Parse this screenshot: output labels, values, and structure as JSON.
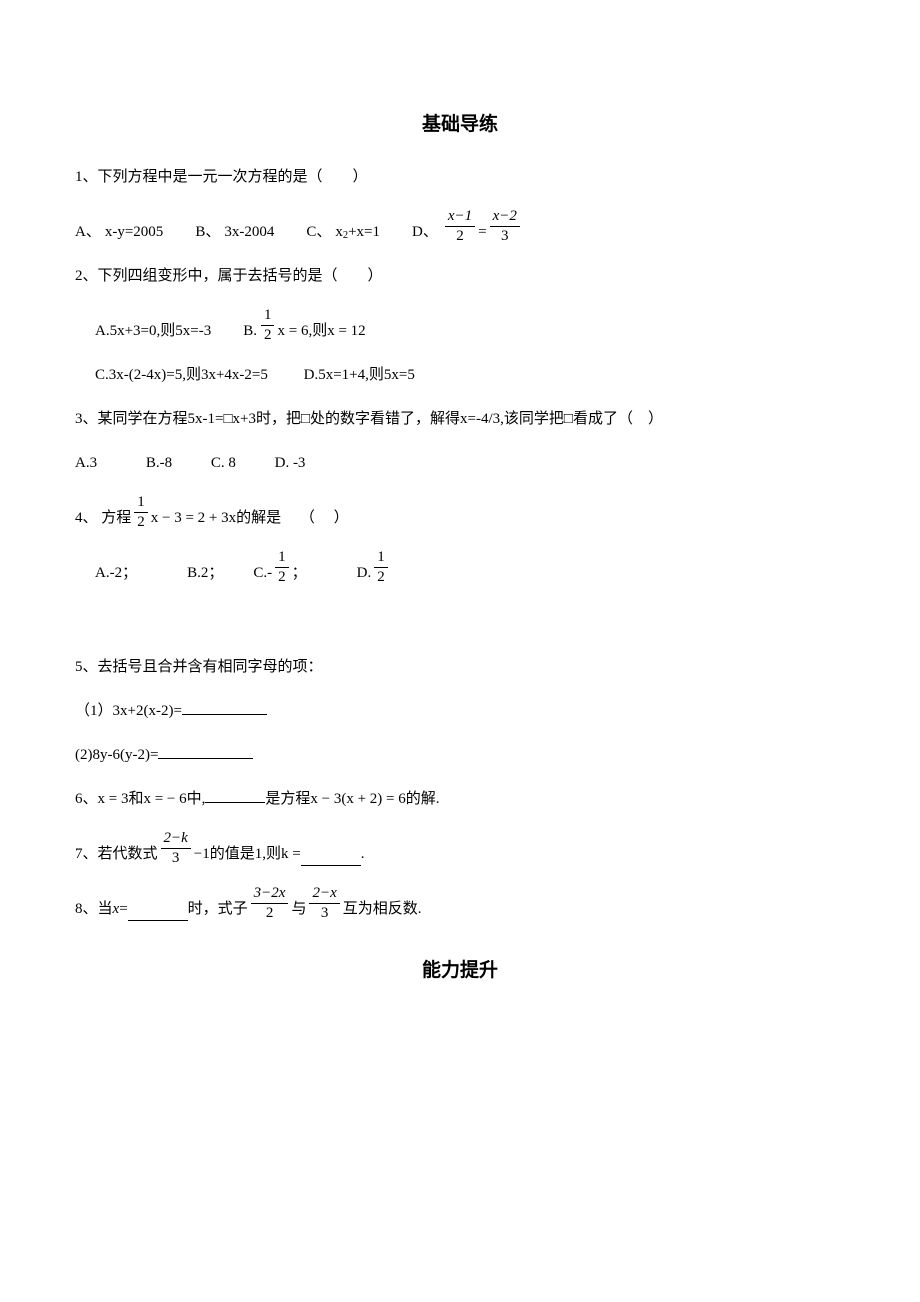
{
  "section_a_title": "基础导练",
  "section_b_title": "能力提升",
  "q1": {
    "stem": "1、下列方程中是一元一次方程的是（　　）",
    "a_lab": "A、",
    "a_txt": "x-y=2005",
    "b_lab": "B、",
    "b_txt": "3x-2004",
    "c_lab": "C、",
    "c_txt_pre": "x",
    "c_txt_post": "+x=1",
    "d_lab": "D、",
    "d_num1": "x−1",
    "d_den1": "2",
    "d_eq": " = ",
    "d_num2": "x−2",
    "d_den2": "3"
  },
  "q2": {
    "stem": "2、下列四组变形中，属于去括号的是（　　）",
    "a": "A.5x+3=0,则5x=-3",
    "b_lab": "B.",
    "b_num": "1",
    "b_den": "2",
    "b_txt": "x = 6,则x = 12",
    "c": "C.3x-(2-4x)=5,则3x+4x-2=5",
    "d": "D.5x=1+4,则5x=5"
  },
  "q3": {
    "stem": "3、某同学在方程5x-1=□x+3时，把□处的数字看错了，解得x=-4/3,该同学把□看成了（　）",
    "a": "A.3",
    "b": "B.-8",
    "c": "C. 8",
    "d": "D. -3"
  },
  "q4": {
    "stem_pre": "4、 方程",
    "num": "1",
    "den": "2",
    "stem_post": " x − 3 = 2 + 3x的解是　 （　 ）",
    "a": "A.-2；",
    "b": "B.2；",
    "c_lab": "C.-",
    "c_num": "1",
    "c_den": "2",
    "c_post": "；",
    "d_lab": "D.",
    "d_num": "1",
    "d_den": "2"
  },
  "q5": {
    "stem": "5、去括号且合并含有相同字母的项：",
    "sub1": "（1）3x+2(x-2)=",
    "sub2": "(2)8y-6(y-2)="
  },
  "q6": {
    "pre": "6、x = 3和x = − 6中,",
    "post": "是方程x − 3(x + 2) = 6的解."
  },
  "q7": {
    "pre": "7、若代数式",
    "num": "2−k",
    "den": "3",
    "minus": "−1",
    "mid": "的值是1,则k = ",
    "post": "."
  },
  "q8": {
    "pre": "8、当",
    "var": "x",
    "eq": "=",
    "mid": "时，式子",
    "num1": "3−2x",
    "den1": "2",
    "conj": "与",
    "num2": "2−x",
    "den2": "3",
    "post": "互为相反数."
  }
}
